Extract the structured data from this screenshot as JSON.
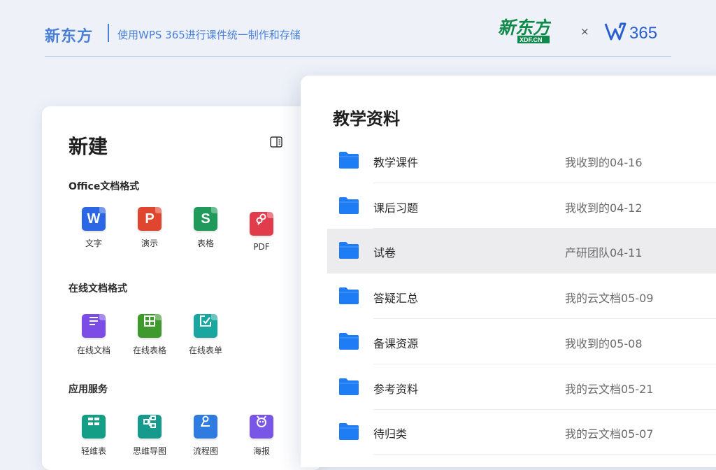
{
  "header": {
    "brand": "新东方",
    "subtitle": "使用WPS 365进行课件统一制作和存储",
    "logo_xdf": "新东方",
    "logo_xdf_sub": "XDF.CN",
    "times": "×",
    "logo_w365": "365"
  },
  "new_panel": {
    "title": "新建",
    "sections": [
      {
        "title": "Office文档格式",
        "items": [
          {
            "label": "文字",
            "glyph": "W",
            "color": "#2b66e5",
            "icon": "wps-writer-icon"
          },
          {
            "label": "演示",
            "glyph": "P",
            "color": "#e0452f",
            "icon": "wps-presentation-icon"
          },
          {
            "label": "表格",
            "glyph": "S",
            "color": "#1f9a5a",
            "icon": "wps-spreadsheet-icon"
          },
          {
            "label": "PDF",
            "glyph": "",
            "color": "#e03c4c",
            "icon": "pdf-icon"
          }
        ]
      },
      {
        "title": "在线文档格式",
        "items": [
          {
            "label": "在线文档",
            "color": "#7c4ce6",
            "icon": "online-document-icon"
          },
          {
            "label": "在线表格",
            "color": "#3f9a2e",
            "icon": "online-sheet-icon"
          },
          {
            "label": "在线表单",
            "color": "#1aa6a0",
            "icon": "online-form-icon"
          }
        ]
      },
      {
        "title": "应用服务",
        "items": [
          {
            "label": "轻维表",
            "color": "#159e86",
            "icon": "light-table-icon"
          },
          {
            "label": "思维导图",
            "color": "#179a8e",
            "icon": "mind-map-icon"
          },
          {
            "label": "流程图",
            "color": "#2f7be0",
            "icon": "flowchart-icon"
          },
          {
            "label": "海报",
            "color": "#7a56e6",
            "icon": "poster-icon"
          }
        ]
      }
    ]
  },
  "file_list": {
    "title": "教学资料",
    "folder_color": "#1e7cf5",
    "rows": [
      {
        "name": "教学课件",
        "meta": "我收到的04-16"
      },
      {
        "name": "课后习题",
        "meta": "我收到的04-12"
      },
      {
        "name": "试卷",
        "meta": "产研团队04-11",
        "selected": true
      },
      {
        "name": "答疑汇总",
        "meta": "我的云文档05-09"
      },
      {
        "name": "备课资源",
        "meta": "我收到的05-08"
      },
      {
        "name": "参考资料",
        "meta": "我的云文档05-21"
      },
      {
        "name": "待归类",
        "meta": "我的云文档05-07"
      }
    ]
  }
}
